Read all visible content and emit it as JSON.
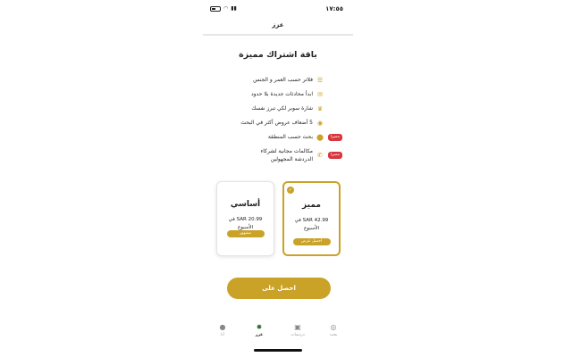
{
  "status_bar": {
    "time": "١٧:٥٥"
  },
  "nav": {
    "title": "عزز"
  },
  "heading": "باقة اشتراك مميزة",
  "features": [
    {
      "text": "فلاتر حسب العمر و الجنس",
      "icon": "sliders-icon"
    },
    {
      "text": "ابدأ محادثات جديدة بلا حدود",
      "icon": "chat-bubbles-icon"
    },
    {
      "text": "شارة سوبر لكي تبرز نفسك",
      "icon": "crown-icon"
    },
    {
      "text": "5 أضعاف عروض أكثر في البحث",
      "icon": "eye-icon"
    },
    {
      "text": "بحث حسب المنطقة",
      "icon": "location-pin-icon",
      "badge": "مميزا"
    },
    {
      "text": "مكالمات مجانية لشركاء الدردشة المجهولين",
      "icon": "phone-icon",
      "badge": "مميزا"
    }
  ],
  "plans": {
    "basic": {
      "title": "أساسي",
      "price": "SAR 20.99 في الأسبوع",
      "button": "مشهور"
    },
    "premium": {
      "title": "مميز",
      "price": "SAR 42.99 في الأسبوع",
      "button": "أحصل عرض"
    }
  },
  "cta": {
    "label": "احصل على"
  },
  "tabs": [
    {
      "label": "بحث",
      "icon": "spiral-search-icon"
    },
    {
      "label": "دردشات",
      "icon": "chat-icon"
    },
    {
      "label": "عزز",
      "icon": "boost-icon",
      "active": true
    },
    {
      "label": "أنا",
      "icon": "user-icon"
    }
  ],
  "colors": {
    "accent": "#c9a227",
    "badge": "#d9363e",
    "active_tab": "#2f6b2f"
  }
}
